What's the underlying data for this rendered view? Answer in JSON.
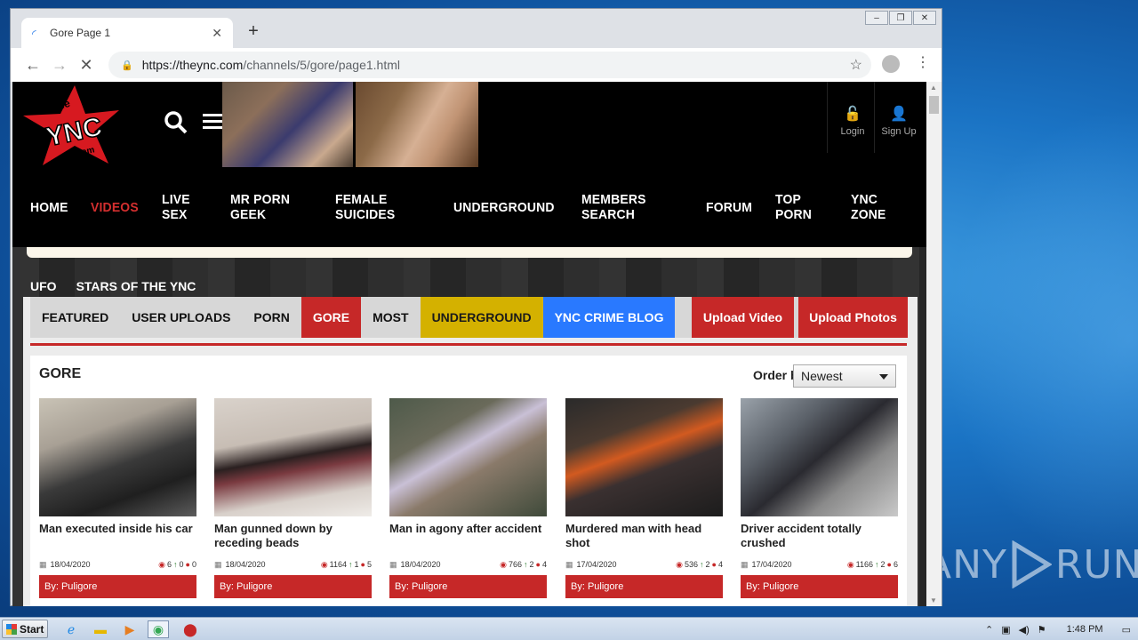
{
  "browser": {
    "tab_title": "Gore Page 1",
    "new_tab": "+",
    "url_host": "https://theync.com",
    "url_path": "/channels/5/gore/page1.html"
  },
  "site": {
    "logo_text": "the YNC .com",
    "header_buttons": {
      "login": "Login",
      "signup": "Sign Up"
    },
    "main_nav": [
      "HOME",
      "VIDEOS",
      "LIVE SEX",
      "MR PORN GEEK",
      "FEMALE SUICIDES",
      "UNDERGROUND",
      "MEMBERS SEARCH",
      "FORUM",
      "TOP PORN",
      "YNC ZONE"
    ],
    "main_nav_active": "VIDEOS",
    "sub_nav": [
      "UFO",
      "STARS OF THE YNC"
    ],
    "categories": [
      "FEATURED",
      "USER UPLOADS",
      "PORN",
      "GORE",
      "MOST",
      "UNDERGROUND",
      "YNC CRIME BLOG"
    ],
    "upload_video": "Upload Video",
    "upload_photos": "Upload Photos",
    "section_title": "GORE",
    "order_by_label": "Order by:",
    "order_by_value": "Newest",
    "videos": [
      {
        "title": "Man executed inside his car",
        "date": "18/04/2020",
        "views": "6",
        "up": "0",
        "comments": "0",
        "author": "By: Puligore"
      },
      {
        "title": "Man gunned down by receding beads",
        "date": "18/04/2020",
        "views": "1164",
        "up": "1",
        "comments": "5",
        "author": "By: Puligore"
      },
      {
        "title": "Man in agony after accident",
        "date": "18/04/2020",
        "views": "766",
        "up": "2",
        "comments": "4",
        "author": "By: Puligore"
      },
      {
        "title": "Murdered man with head shot",
        "date": "17/04/2020",
        "views": "536",
        "up": "2",
        "comments": "4",
        "author": "By: Puligore"
      },
      {
        "title": "Driver accident totally crushed",
        "date": "17/04/2020",
        "views": "1166",
        "up": "2",
        "comments": "6",
        "author": "By: Puligore"
      }
    ]
  },
  "taskbar": {
    "start": "Start",
    "clock": "1:48 PM"
  },
  "watermark": {
    "left": "ANY",
    "right": "RUN"
  },
  "colors": {
    "accent_red": "#c62828",
    "underground_yellow": "#d4b100",
    "crime_blue": "#2979ff"
  }
}
